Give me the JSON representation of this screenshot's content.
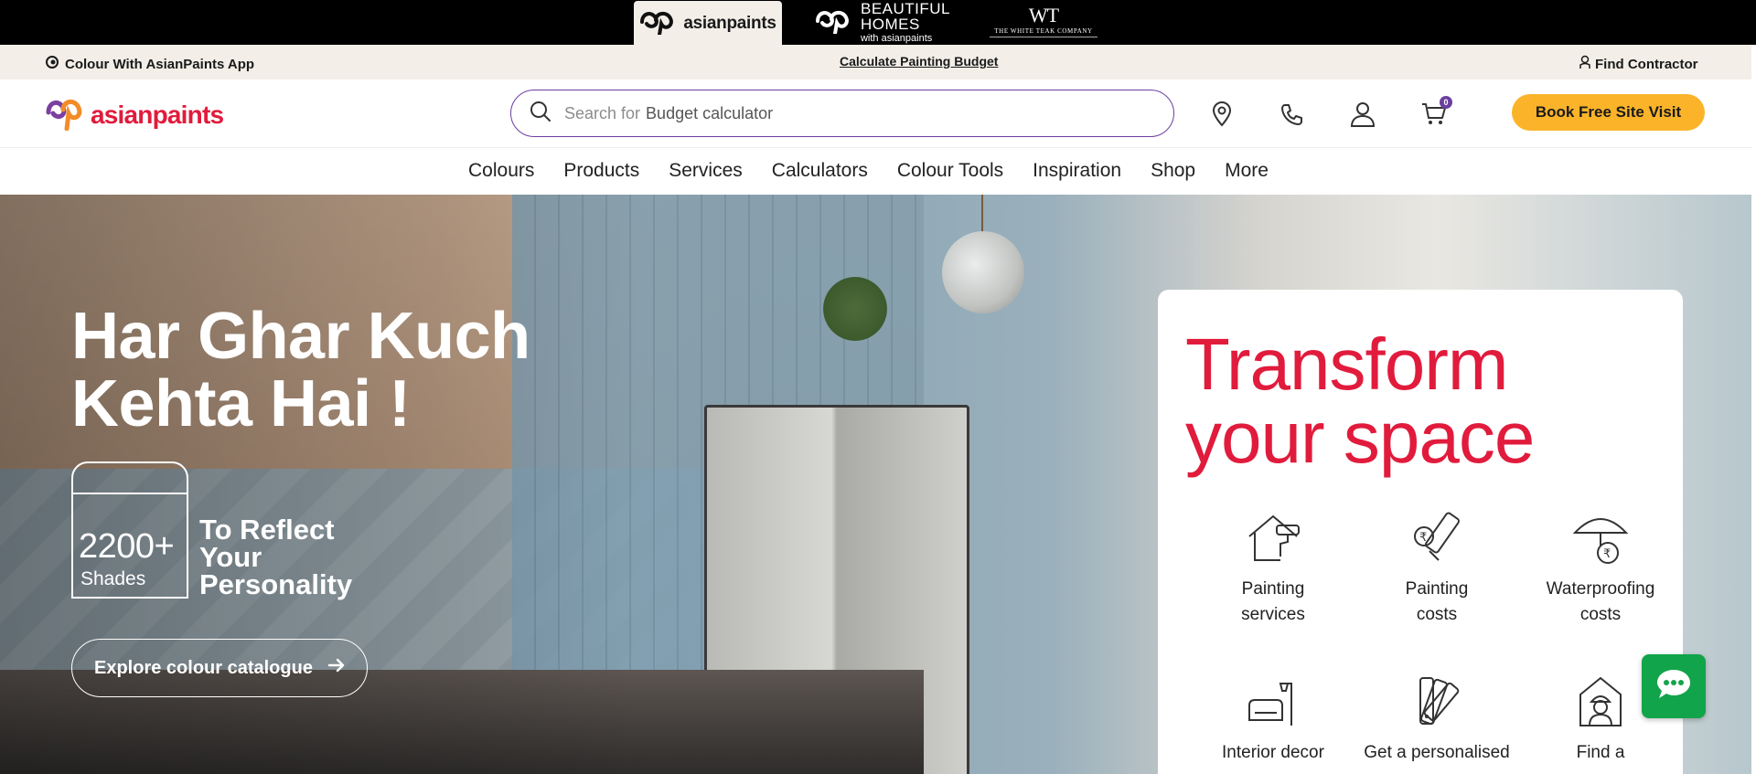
{
  "brand_strip": {
    "asianpaints": "asianpaints",
    "beautiful_homes_line1": "BEAUTIFUL",
    "beautiful_homes_line2": "HOMES",
    "beautiful_homes_line3": "with asianpaints",
    "white_teak_mono": "WT",
    "white_teak_name": "THE WHITE TEAK COMPANY"
  },
  "utility_bar": {
    "app_link": "Colour With AsianPaints App",
    "budget_link": "Calculate Painting Budget",
    "contractor_link": "Find Contractor"
  },
  "header": {
    "logo_text": "asianpaints",
    "search_prefix": "Search for",
    "search_suggestion": "Budget calculator",
    "cart_count": "0",
    "cta_label": "Book Free Site Visit",
    "icons": [
      "location-icon",
      "phone-icon",
      "user-icon",
      "cart-icon"
    ]
  },
  "nav": {
    "items": [
      "Colours",
      "Products",
      "Services",
      "Calculators",
      "Colour Tools",
      "Inspiration",
      "Shop",
      "More"
    ]
  },
  "hero": {
    "title_line1": "Har Ghar Kuch",
    "title_line2": "Kehta Hai !",
    "shades_count": "2200+",
    "shades_label": "Shades",
    "reflect_line1": "To Reflect",
    "reflect_line2": "Your",
    "reflect_line3": "Personality",
    "cta_label": "Explore colour catalogue"
  },
  "card": {
    "title_line1": "Transform",
    "title_line2": "your space",
    "services": [
      {
        "line1": "Painting",
        "line2": "services",
        "icon": "house-roller-icon"
      },
      {
        "line1": "Painting",
        "line2": "costs",
        "icon": "coin-roller-icon"
      },
      {
        "line1": "Waterproofing",
        "line2": "costs",
        "icon": "umbrella-rupee-icon"
      },
      {
        "line1": "Interior decor",
        "line2": "",
        "icon": "sofa-lamp-icon"
      },
      {
        "line1": "Get a personalised",
        "line2": "",
        "icon": "colour-swatch-icon"
      },
      {
        "line1": "Find a",
        "line2": "",
        "icon": "contractor-icon"
      }
    ]
  },
  "colors": {
    "brand_red": "#e11b3c",
    "accent_purple": "#6b3fa0",
    "cta_yellow": "#fbb42a",
    "utility_bg": "#f3efe8",
    "chat_green": "#12a44a"
  }
}
